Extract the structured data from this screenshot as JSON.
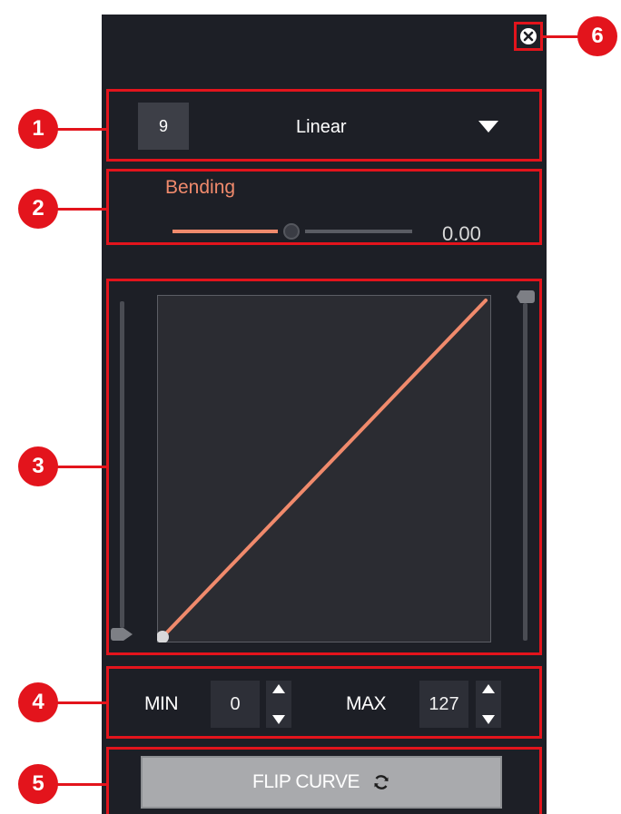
{
  "preset": {
    "number": "9",
    "name": "Linear"
  },
  "bending": {
    "label": "Bending",
    "value": "0.00",
    "slider_fraction": 0.5
  },
  "curve": {
    "type": "linear",
    "start": [
      0,
      0
    ],
    "end": [
      1,
      1
    ]
  },
  "range": {
    "min_label": "MIN",
    "min_value": "0",
    "max_label": "MAX",
    "max_value": "127"
  },
  "flip": {
    "label": "FLIP CURVE"
  },
  "callouts": [
    "1",
    "2",
    "3",
    "4",
    "5",
    "6"
  ],
  "colors": {
    "panel": "#1d1f26",
    "accent": "#f08a6c",
    "callout": "#e3141c"
  }
}
